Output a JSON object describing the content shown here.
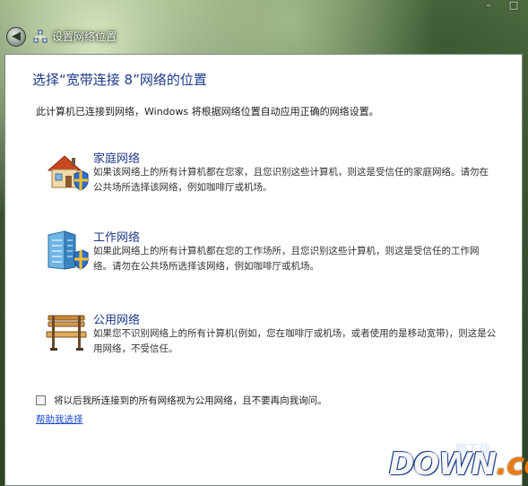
{
  "window": {
    "title": "设置网络位置",
    "caption_buttons": [
      "–",
      "□"
    ],
    "back_glyph": "◀"
  },
  "heading": "选择“宽带连接  8”网络的位置",
  "intro": "此计算机已连接到网络，Windows 将根据网络位置自动应用正确的网络设置。",
  "options": [
    {
      "title": "家庭网络",
      "description": "如果该网络上的所有计算机都在您家，且您识别这些计算机，则这是受信任的家庭网络。请勿在公共场所选择该网络，例如咖啡厅或机场。",
      "icon": "home-shield-icon"
    },
    {
      "title": "工作网络",
      "description": "如果此网络上的所有计算机都在您的工作场所，且您识别这些计算机，则这是受信任的工作网络。请勿在公共场所选择该网络，例如咖啡厅或机场。",
      "icon": "office-building-shield-icon"
    },
    {
      "title": "公用网络",
      "description": "如果您不识别网络上的所有计算机(例如，您在咖啡厅或机场，或者使用的是移动宽带)，则这是公用网络，不受信任。",
      "icon": "park-bench-icon"
    }
  ],
  "checkbox": {
    "label": "将以后我所连接到的所有网络视为公用网络，且不要再向我询问。",
    "checked": false
  },
  "help_link": "帮助我选择",
  "watermark": {
    "text_main": "DOWN",
    "text_dot": ".cc",
    "text_top": "腾下载"
  },
  "colors": {
    "heading_blue": "#1e3a8a",
    "link_blue": "#1a4ad0",
    "panel_bg": "#ffffff"
  }
}
